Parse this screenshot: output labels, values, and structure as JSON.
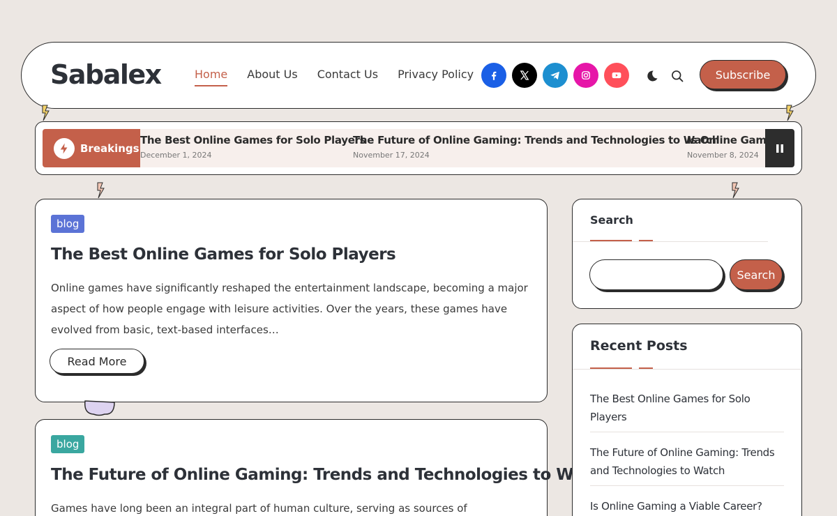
{
  "site": {
    "logo": "Sabalex"
  },
  "nav": {
    "items": [
      {
        "label": "Home",
        "active": true
      },
      {
        "label": "About Us",
        "active": false
      },
      {
        "label": "Contact Us",
        "active": false
      },
      {
        "label": "Privacy Policy",
        "active": false
      }
    ]
  },
  "socials": [
    {
      "name": "facebook-icon",
      "color": "#1a5fe6"
    },
    {
      "name": "x-icon",
      "color": "#000000"
    },
    {
      "name": "telegram-icon",
      "color": "#1d8fd0"
    },
    {
      "name": "instagram-icon",
      "color": "#e616a8"
    },
    {
      "name": "youtube-icon",
      "color": "#ff4f5a"
    }
  ],
  "header": {
    "subscribe_label": "Subscribe"
  },
  "ticker": {
    "label": "Breakings",
    "items": [
      {
        "title": "The Best Online Games for Solo Players",
        "date": "December 1, 2024"
      },
      {
        "title": "The Future of Online Gaming: Trends and Technologies to Watch",
        "date": "November 17, 2024"
      },
      {
        "title": "Is Online Gaming a Viable Career?",
        "date": "November 8, 2024"
      }
    ]
  },
  "posts": [
    {
      "category": "blog",
      "category_color": "#5b73d6",
      "title": "The Best Online Games for Solo Players",
      "excerpt": "Online games have significantly reshaped the entertainment landscape, becoming a major aspect of how people engage with leisure activities. Over the years, these games have evolved from basic, text-based interfaces…",
      "read_more": "Read More"
    },
    {
      "category": "blog",
      "category_color": "#3aa7a0",
      "title": "The Future of Online Gaming: Trends and Technologies to Watch",
      "excerpt": "Games have long been an integral part of human culture, serving as sources of"
    }
  ],
  "sidebar": {
    "search": {
      "title": "Search",
      "placeholder": "",
      "button": "Search"
    },
    "recent": {
      "title": "Recent Posts",
      "items": [
        "The Best Online Games for Solo Players",
        "The Future of Online Gaming: Trends and Technologies to Watch",
        "Is Online Gaming a Viable Career?"
      ]
    }
  }
}
